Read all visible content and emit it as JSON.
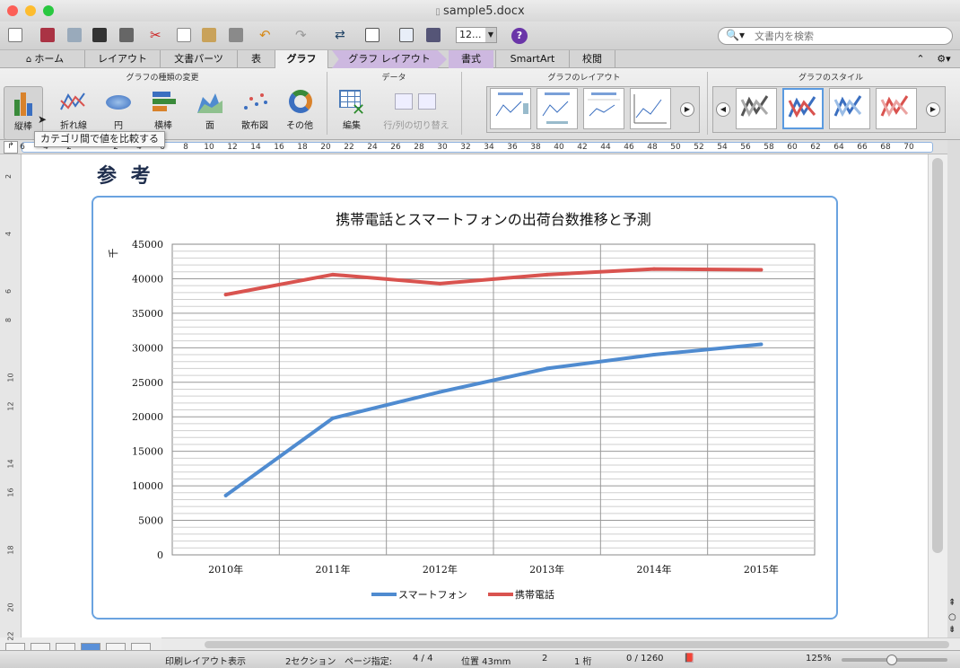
{
  "window": {
    "title": "sample5.docx"
  },
  "toolbar": {
    "zoom_value": "12...",
    "search_placeholder": "文書内を検索",
    "help_label": "?"
  },
  "tabs": [
    "ホーム",
    "レイアウト",
    "文書パーツ",
    "表",
    "グラフ",
    "グラフ レイアウト",
    "書式",
    "SmartArt",
    "校閲"
  ],
  "ribbon": {
    "group_chart_type": "グラフの種類の変更",
    "group_data": "データ",
    "group_layout": "グラフのレイアウト",
    "group_style": "グラフのスタイル",
    "buttons": [
      "縦棒",
      "折れ線",
      "円",
      "横棒",
      "面",
      "散布図",
      "その他"
    ],
    "data_buttons": [
      "編集",
      "行/列の切り替え"
    ]
  },
  "tooltip": "カテゴリ間で値を比較する",
  "ruler": {
    "numbers": [
      "6",
      "4",
      "2",
      "",
      "2",
      "4",
      "6",
      "8",
      "10",
      "12",
      "14",
      "16",
      "18",
      "20",
      "22",
      "24",
      "26",
      "28",
      "30",
      "32",
      "34",
      "36",
      "38",
      "40",
      "42",
      "44",
      "46",
      "48",
      "50",
      "52",
      "54",
      "56",
      "58",
      "60",
      "62",
      "64",
      "66",
      "68",
      "70"
    ]
  },
  "vruler": {
    "numbers": [
      "2",
      "",
      "4",
      "",
      "6",
      "8",
      "",
      "10",
      "12",
      "",
      "14",
      "16",
      "",
      "18",
      "",
      "20",
      "22"
    ]
  },
  "document": {
    "heading": "参 考"
  },
  "chart_data": {
    "type": "line",
    "title": "携帯電話とスマートフォンの出荷台数推移と予測",
    "ylabel": "千",
    "xlabel": "",
    "categories": [
      "2010年",
      "2011年",
      "2012年",
      "2013年",
      "2014年",
      "2015年"
    ],
    "yticks": [
      "0",
      "5000",
      "10000",
      "15000",
      "20000",
      "25000",
      "30000",
      "35000",
      "40000",
      "45000"
    ],
    "ylim": [
      0,
      45000
    ],
    "series": [
      {
        "name": "スマートフォン",
        "color": "#4f8bd0",
        "values": [
          8600,
          19800,
          23600,
          27000,
          29000,
          30500
        ]
      },
      {
        "name": "携帯電話",
        "color": "#d9534f",
        "values": [
          37700,
          40600,
          39300,
          40600,
          41400,
          41300
        ]
      }
    ],
    "legend": "bottom",
    "grid": true
  },
  "status": {
    "view": "印刷レイアウト表示",
    "section": "2セクション",
    "page_label": "ページ指定:",
    "page": "4 / 4",
    "position": "位置 43mm",
    "line": "2",
    "col": "1 桁",
    "words": "0 / 1260",
    "zoom": "125%"
  }
}
